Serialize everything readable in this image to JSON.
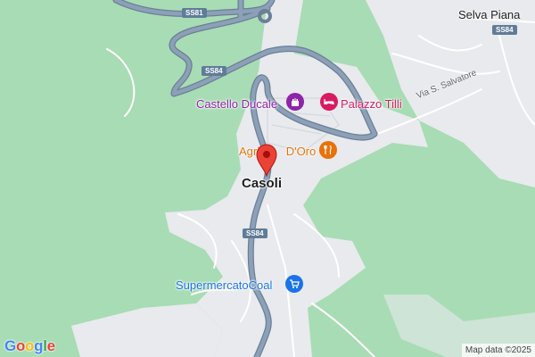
{
  "map": {
    "places": {
      "casoli": "Casoli",
      "selva_piana": "Selva Piana"
    },
    "pois": {
      "castello_ducale": "Castello Ducale",
      "palazzo_tilli": "Palazzo Tilli",
      "agriturismo": "Agrit",
      "agriturismo_end": "D'Oro",
      "supermercato": "SupermercatoCoal"
    },
    "streets": {
      "via_s_salvatore": "Via S. Salvatore"
    },
    "road_shields": {
      "ss81": "SS81",
      "ss84_top": "SS84",
      "ss84_mid": "SS84",
      "ss84_right": "SS84"
    },
    "icons": {
      "castle": "castle-icon",
      "hotel": "hotel-icon",
      "restaurant": "restaurant-icon",
      "shopping": "shopping-cart-icon",
      "pin": "map-pin-icon"
    },
    "colors": {
      "forest": "#a8dcb4",
      "urban": "#e8eaed",
      "highway": "#8ca0b8",
      "pin": "#ea4335",
      "poi_purple": "#8e24aa",
      "poi_pink": "#d81b60",
      "poi_orange": "#e8710a",
      "poi_blue": "#1a73e8"
    }
  },
  "footer": {
    "logo": [
      "G",
      "o",
      "o",
      "g",
      "l",
      "e"
    ],
    "attribution": "Map data ©2025"
  }
}
